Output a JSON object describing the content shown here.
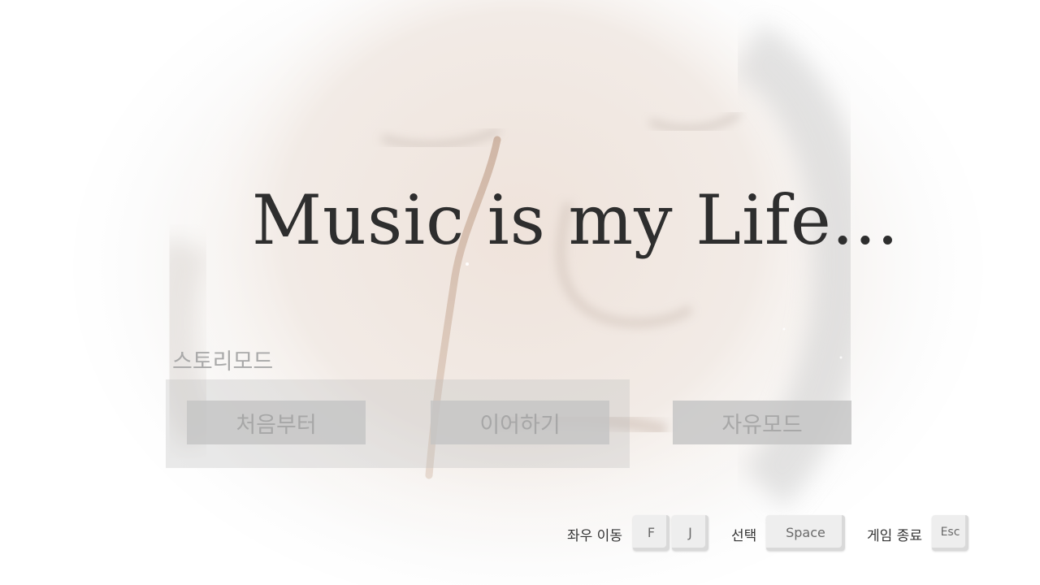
{
  "title": "Music is my Life...",
  "story_mode": {
    "label": "스토리모드",
    "buttons": {
      "start": "처음부터",
      "continue": "이어하기"
    }
  },
  "free_mode": "자유모드",
  "controls": {
    "move_label": "좌우 이동",
    "move_keys": [
      "F",
      "J"
    ],
    "select_label": "선택",
    "select_key": "Space",
    "quit_label": "게임 종료",
    "quit_key": "Esc"
  },
  "colors": {
    "title": "#2e2e2e",
    "button_bg": "#c4c4c4",
    "button_text": "#a7a7a7",
    "panel_bg": "#bebebe"
  }
}
